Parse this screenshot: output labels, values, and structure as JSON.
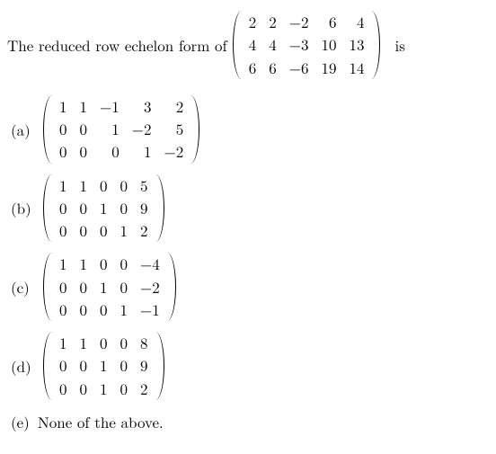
{
  "question": {
    "prefix": "The reduced row echelon form of",
    "trailing": "is",
    "matrix": [
      [
        "2",
        "2",
        "−2",
        "6",
        "4"
      ],
      [
        "4",
        "4",
        "−3",
        "10",
        "13"
      ],
      [
        "6",
        "6",
        "−6",
        "19",
        "14"
      ]
    ]
  },
  "options": {
    "a": {
      "label": "(a)",
      "matrix": [
        [
          "1",
          "1",
          "−1",
          "3",
          "2"
        ],
        [
          "0",
          "0",
          "1",
          "−2",
          "5"
        ],
        [
          "0",
          "0",
          "0",
          "1",
          "−2"
        ]
      ]
    },
    "b": {
      "label": "(b)",
      "matrix": [
        [
          "1",
          "1",
          "0",
          "0",
          "5"
        ],
        [
          "0",
          "0",
          "1",
          "0",
          "9"
        ],
        [
          "0",
          "0",
          "0",
          "1",
          "2"
        ]
      ]
    },
    "c": {
      "label": "(c)",
      "matrix": [
        [
          "1",
          "1",
          "0",
          "0",
          "−4"
        ],
        [
          "0",
          "0",
          "1",
          "0",
          "−2"
        ],
        [
          "0",
          "0",
          "0",
          "1",
          "−1"
        ]
      ]
    },
    "d": {
      "label": "(d)",
      "matrix": [
        [
          "1",
          "1",
          "0",
          "0",
          "8"
        ],
        [
          "0",
          "0",
          "1",
          "0",
          "9"
        ],
        [
          "0",
          "0",
          "1",
          "0",
          "2"
        ]
      ]
    },
    "e": {
      "label": "(e)",
      "text": "None of the above."
    }
  }
}
